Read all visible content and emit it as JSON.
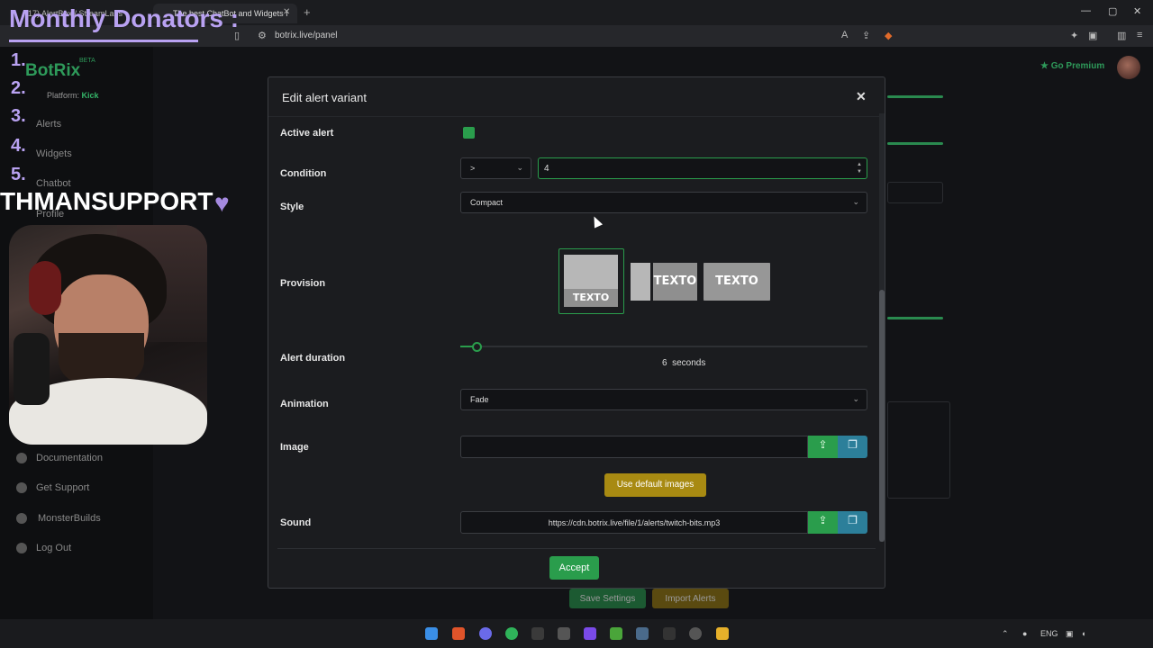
{
  "browser": {
    "tabs": [
      {
        "label": "(17) AlertBox / StreamLabs"
      },
      {
        "label": "The best ChatBot and Widgets f"
      }
    ],
    "url": "botrix.live/panel"
  },
  "app": {
    "brand": "BotRix",
    "beta": "BETA",
    "platform_label": "Platform:",
    "platform_value": "Kick",
    "nav": [
      "Alerts",
      "Widgets",
      "Chatbot",
      "Profile"
    ],
    "nav_bottom": [
      "Documentation",
      "Get Support",
      "MonsterBuilds",
      "Log Out"
    ],
    "premium": "Go Premium",
    "save_settings": "Save Settings",
    "import_alerts": "Import Alerts"
  },
  "overlay": {
    "title": "Monthly Donators :",
    "ranks": [
      "1.",
      "2.",
      "3.",
      "4.",
      "5."
    ],
    "support": "THMANSUPPORT"
  },
  "modal": {
    "title": "Edit alert variant",
    "active_label": "Active alert",
    "condition_label": "Condition",
    "condition_operator": ">",
    "condition_value": "4",
    "style_label": "Style",
    "style_value": "Compact",
    "provision_label": "Provision",
    "provision_text": "TEXTO",
    "duration_label": "Alert duration",
    "duration_value": "6",
    "duration_unit": "seconds",
    "duration_fraction": 0.04,
    "animation_label": "Animation",
    "animation_value": "Fade",
    "image_label": "Image",
    "image_value": "",
    "default_images": "Use default images",
    "sound_label": "Sound",
    "sound_value": "https://cdn.botrix.live/file/1/alerts/twitch-bits.mp3",
    "accept": "Accept"
  },
  "taskbar": {
    "lang": "ENG"
  },
  "colors": {
    "accent": "#2a9d4c",
    "overlay": "#b9a2f2",
    "gold": "#a88a12",
    "blue": "#2c7f9a"
  }
}
